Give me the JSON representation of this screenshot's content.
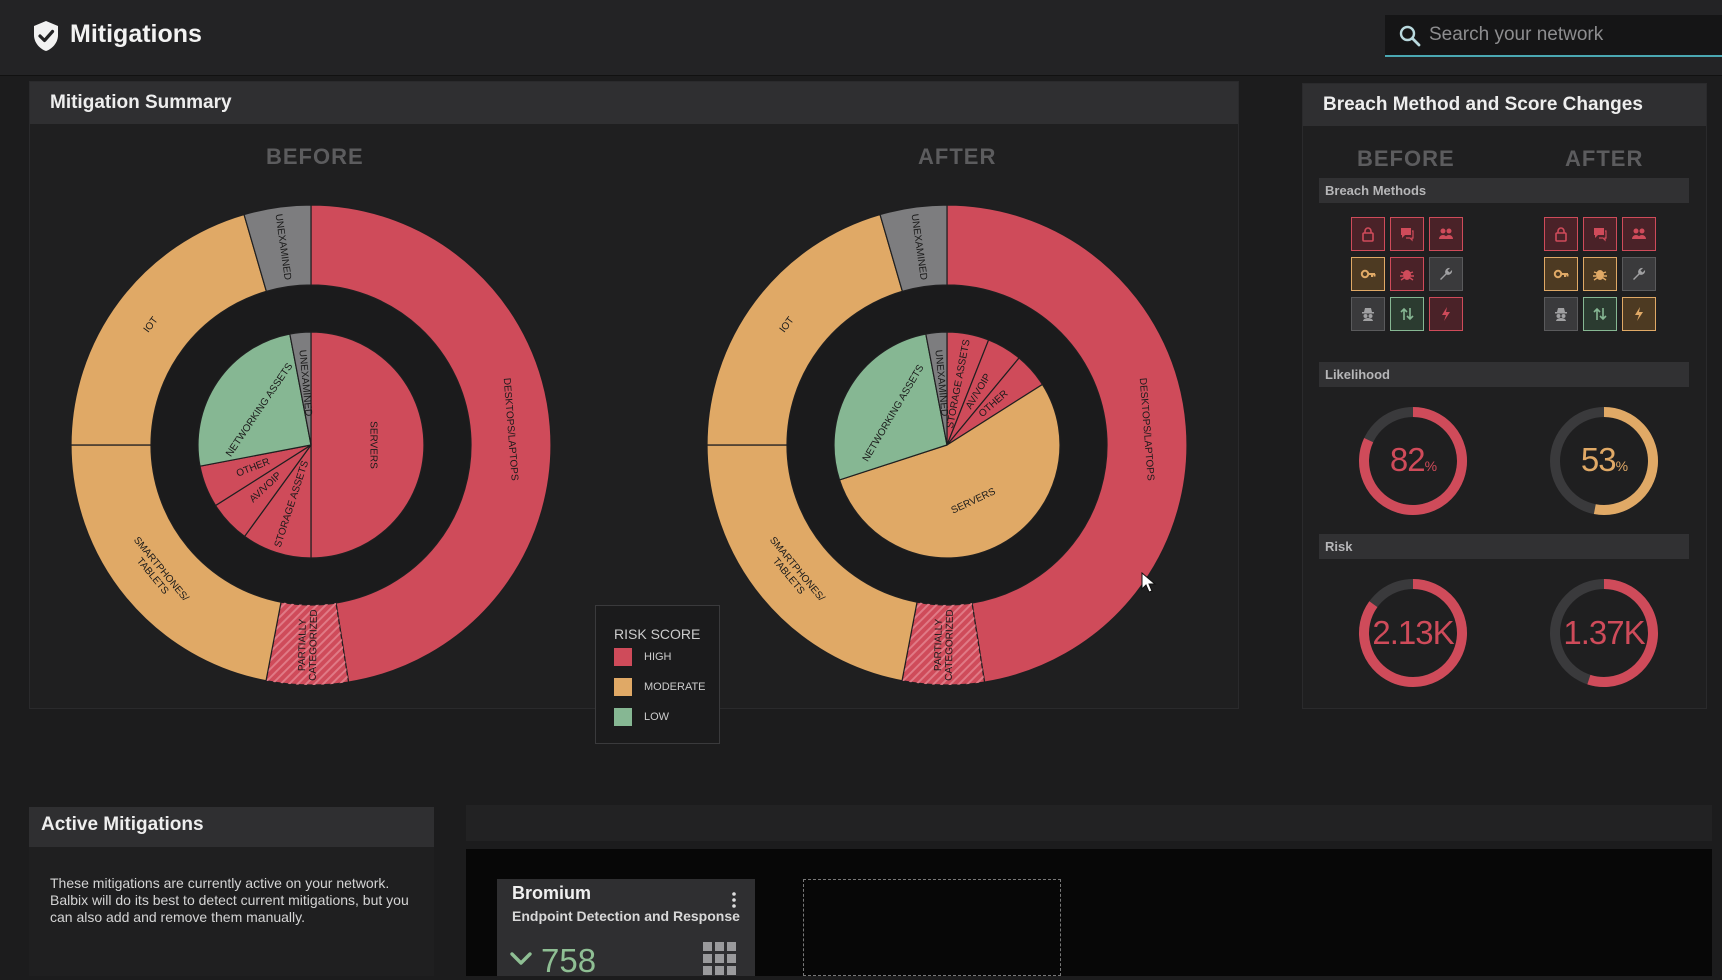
{
  "app": {
    "title": "Mitigations",
    "search_placeholder": "Search your network"
  },
  "summary": {
    "title": "Mitigation Summary",
    "before_label": "BEFORE",
    "after_label": "AFTER",
    "legend": {
      "title": "RISK SCORE",
      "items": [
        {
          "label": "HIGH",
          "color": "#cf4b5a"
        },
        {
          "label": "MODERATE",
          "color": "#e0a966"
        },
        {
          "label": "LOW",
          "color": "#86b793"
        }
      ]
    }
  },
  "chart_data": [
    {
      "type": "pie",
      "title": "BEFORE",
      "outer_ring": [
        {
          "label": "DESKTOPS/LAPTOPS",
          "value": 47.5,
          "risk": "HIGH"
        },
        {
          "label": "PARTIALLY CATEGORIZED",
          "value": 5.5,
          "risk": "HIGH"
        },
        {
          "label": "SMARTPHONES/ TABLETS",
          "value": 22,
          "risk": "MODERATE"
        },
        {
          "label": "IOT",
          "value": 20.5,
          "risk": "MODERATE"
        },
        {
          "label": "UNEXAMINED",
          "value": 4.5,
          "risk": "NONE"
        }
      ],
      "inner_pie": [
        {
          "label": "SERVERS",
          "value": 50,
          "risk": "HIGH"
        },
        {
          "label": "STORAGE ASSETS",
          "value": 10,
          "risk": "HIGH"
        },
        {
          "label": "AV/VOIP",
          "value": 6,
          "risk": "HIGH"
        },
        {
          "label": "OTHER",
          "value": 6,
          "risk": "HIGH"
        },
        {
          "label": "NETWORKING ASSETS",
          "value": 25,
          "risk": "LOW"
        },
        {
          "label": "UNEXAMINED",
          "value": 3,
          "risk": "NONE"
        }
      ]
    },
    {
      "type": "pie",
      "title": "AFTER",
      "outer_ring": [
        {
          "label": "DESKTOPS/LAPTOPS",
          "value": 47.5,
          "risk": "HIGH"
        },
        {
          "label": "PARTIALLY CATEGORIZED",
          "value": 5.5,
          "risk": "HIGH"
        },
        {
          "label": "SMARTPHONES/ TABLETS",
          "value": 22,
          "risk": "MODERATE"
        },
        {
          "label": "IOT",
          "value": 20.5,
          "risk": "MODERATE"
        },
        {
          "label": "UNEXAMINED",
          "value": 4.5,
          "risk": "NONE"
        }
      ],
      "inner_pie": [
        {
          "label": "STORAGE ASSETS",
          "value": 6,
          "risk": "HIGH"
        },
        {
          "label": "AV/VOIP",
          "value": 5,
          "risk": "HIGH"
        },
        {
          "label": "OTHER",
          "value": 5,
          "risk": "HIGH"
        },
        {
          "label": "SERVERS",
          "value": 54,
          "risk": "MODERATE"
        },
        {
          "label": "NETWORKING ASSETS",
          "value": 27,
          "risk": "LOW"
        },
        {
          "label": "UNEXAMINED",
          "value": 3,
          "risk": "NONE"
        }
      ]
    }
  ],
  "breach": {
    "title": "Breach Method and Score Changes",
    "before_label": "BEFORE",
    "after_label": "AFTER",
    "breach_methods_label": "Breach Methods",
    "likelihood_label": "Likelihood",
    "risk_label": "Risk",
    "before_tiles": [
      {
        "icon": "lock-icon",
        "status": "high"
      },
      {
        "icon": "chat-icon",
        "status": "high"
      },
      {
        "icon": "users-icon",
        "status": "high"
      },
      {
        "icon": "key-icon",
        "status": "moderate"
      },
      {
        "icon": "bug-icon",
        "status": "high"
      },
      {
        "icon": "wrench-icon",
        "status": "none"
      },
      {
        "icon": "spy-icon",
        "status": "none"
      },
      {
        "icon": "transfer-icon",
        "status": "low"
      },
      {
        "icon": "bolt-icon",
        "status": "high"
      }
    ],
    "after_tiles": [
      {
        "icon": "lock-icon",
        "status": "high"
      },
      {
        "icon": "chat-icon",
        "status": "high"
      },
      {
        "icon": "users-icon",
        "status": "high"
      },
      {
        "icon": "key-icon",
        "status": "moderate"
      },
      {
        "icon": "bug-icon",
        "status": "moderate"
      },
      {
        "icon": "wrench-icon",
        "status": "none"
      },
      {
        "icon": "spy-icon",
        "status": "none"
      },
      {
        "icon": "transfer-icon",
        "status": "low"
      },
      {
        "icon": "bolt-icon",
        "status": "moderate"
      }
    ],
    "likelihood_before": {
      "value": "82",
      "unit": "%",
      "fraction": 0.82,
      "color": "#cf4b5a"
    },
    "likelihood_after": {
      "value": "53",
      "unit": "%",
      "fraction": 0.53,
      "color": "#e0a966"
    },
    "risk_before": {
      "value": "2.13K",
      "fraction": 0.85,
      "color": "#cf4b5a"
    },
    "risk_after": {
      "value": "1.37K",
      "fraction": 0.55,
      "color": "#cf4b5a"
    }
  },
  "active": {
    "title": "Active Mitigations",
    "description": "These mitigations are currently active on your network. Balbix will do its best to detect current mitigations, but you can also add and remove them manually."
  },
  "card": {
    "title": "Bromium",
    "subtitle": "Endpoint Detection and Response",
    "score": "758"
  },
  "colors": {
    "high": "#cf4b5a",
    "moderate": "#e0a966",
    "low": "#86b793",
    "none": "#7d7d7f",
    "accent": "#4aa7b2"
  }
}
